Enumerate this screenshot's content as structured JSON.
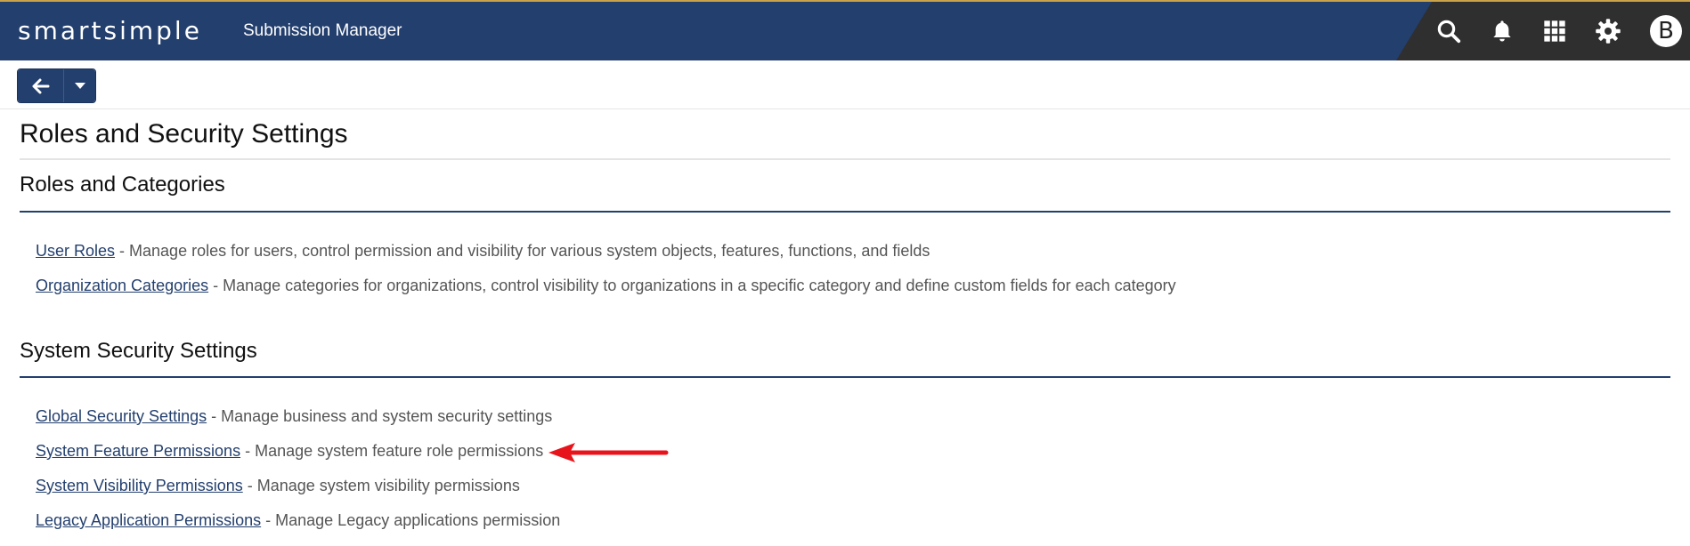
{
  "header": {
    "logo": "smartsimple",
    "app_title": "Submission Manager",
    "icons": [
      "search-icon",
      "bell-icon",
      "apps-grid-icon",
      "gear-icon"
    ],
    "avatar_letter": "B",
    "colors": {
      "bar": "#233f6e",
      "right": "#2f2f2f",
      "accent": "#c9a24a"
    }
  },
  "toolbar": {
    "back_icon": "arrow-left-icon",
    "dropdown_icon": "caret-down-icon"
  },
  "page": {
    "title": "Roles and Security Settings"
  },
  "sections": [
    {
      "title": "Roles and Categories",
      "items": [
        {
          "link": "User Roles",
          "desc": " - Manage roles for users, control permission and visibility for various system objects, features, functions, and fields"
        },
        {
          "link": "Organization Categories",
          "desc": " - Manage categories for organizations, control visibility to organizations in a specific category and define custom fields for each category"
        }
      ]
    },
    {
      "title": "System Security Settings",
      "items": [
        {
          "link": "Global Security Settings",
          "desc": " - Manage business and system security settings"
        },
        {
          "link": "System Feature Permissions",
          "desc": " - Manage system feature role permissions"
        },
        {
          "link": "System Visibility Permissions",
          "desc": " - Manage system visibility permissions"
        },
        {
          "link": "Legacy Application Permissions",
          "desc": " - Manage Legacy applications permission"
        }
      ]
    }
  ],
  "annotation": {
    "arrow_color": "#e8141c",
    "points_to": "System Feature Permissions"
  }
}
